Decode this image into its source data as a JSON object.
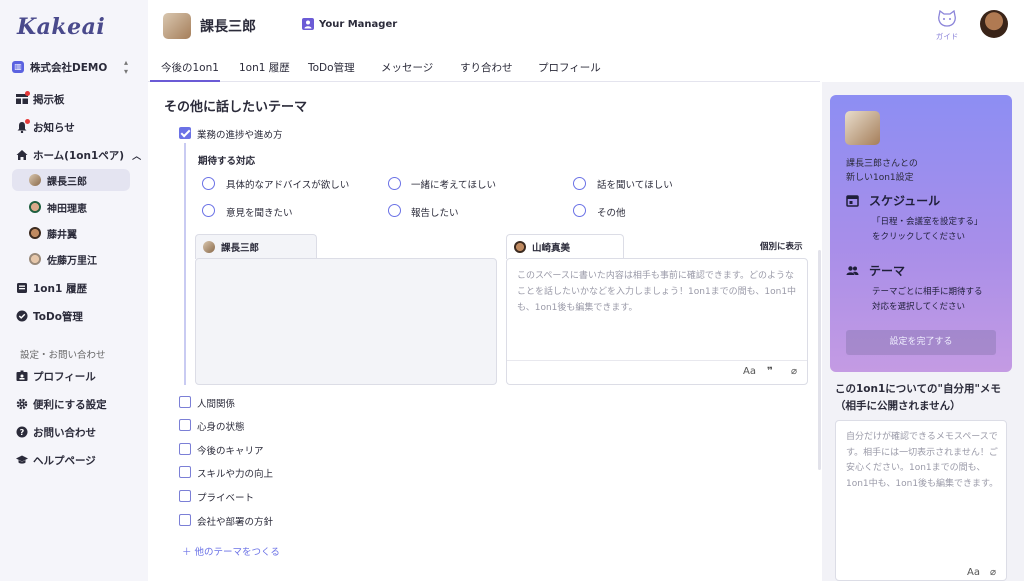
{
  "app": {
    "logo": "Kakeai"
  },
  "sidebar": {
    "company": "株式会社DEMO",
    "items": [
      {
        "label": "掲示板"
      },
      {
        "label": "お知らせ"
      },
      {
        "label": "ホーム(1on1ペア)"
      }
    ],
    "pairs": [
      {
        "label": "課長三郎"
      },
      {
        "label": "神田理恵"
      },
      {
        "label": "藤井翼"
      },
      {
        "label": "佐藤万里江"
      }
    ],
    "items2": [
      {
        "label": "1on1 履歴"
      },
      {
        "label": "ToDo管理"
      }
    ],
    "section_label": "設定・お問い合わせ",
    "settings": [
      {
        "label": "プロフィール"
      },
      {
        "label": "便利にする設定"
      },
      {
        "label": "お問い合わせ"
      },
      {
        "label": "ヘルプページ"
      }
    ]
  },
  "header": {
    "name": "課長三郎",
    "manager_label": "Your Manager",
    "guide_label": "ガイド"
  },
  "tabs": [
    {
      "label": "今後の1on1"
    },
    {
      "label": "1on1 履歴"
    },
    {
      "label": "ToDo管理"
    },
    {
      "label": "メッセージ"
    },
    {
      "label": "すり合わせ"
    },
    {
      "label": "プロフィール"
    }
  ],
  "main": {
    "title": "その他に話したいテーマ",
    "checked_theme": "業務の進捗や進め方",
    "expect_title": "期待する対応",
    "radios": [
      "具体的なアドバイスが欲しい",
      "一緒に考えてほしい",
      "話を聞いてほしい",
      "意見を聞きたい",
      "報告したい",
      "その他"
    ],
    "left_card_person": "課長三郎",
    "right_card_person": "山崎真美",
    "separate_label": "個別に表示",
    "right_placeholder": "このスペースに書いた内容は相手も事前に確認できます。どのようなことを話したいかなどを入力しましょう！1on1までの間も、1on1中も、1on1後も編集できます。",
    "toolbar": {
      "text": "Aa",
      "quote": "❞",
      "attach": "⌀"
    },
    "themes": [
      "人間関係",
      "心身の状態",
      "今後のキャリア",
      "スキルや力の向上",
      "プライベート",
      "会社や部署の方針"
    ],
    "add_theme": "＋  他のテーマをつくる"
  },
  "right_panel": {
    "setup_line1": "課長三郎さんとの",
    "setup_line2": "新しい1on1設定",
    "schedule_title": "スケジュール",
    "schedule_desc1": "「日程・会議室を設定する」",
    "schedule_desc2": "をクリックしてください",
    "theme_title": "テーマ",
    "theme_desc1": "テーマごとに相手に期待する",
    "theme_desc2": "対応を選択してください",
    "complete_button": "設定を完了する",
    "memo_title1": "この1on1についての\"自分用\"メモ",
    "memo_title2": "（相手に公開されません）",
    "memo_placeholder": "自分だけが確認できるメモスペースです。相手には一切表示されません！ご安心ください。1on1までの間も、1on1中も、1on1後も編集できます。",
    "memo_toolbar": {
      "text": "Aa",
      "attach": "⌀"
    }
  },
  "colors": {
    "accent": "#6b72e6",
    "brand": "#4a4a8c",
    "setup_gradient_top": "#8d8ef3",
    "setup_gradient_bottom": "#c49be3"
  }
}
